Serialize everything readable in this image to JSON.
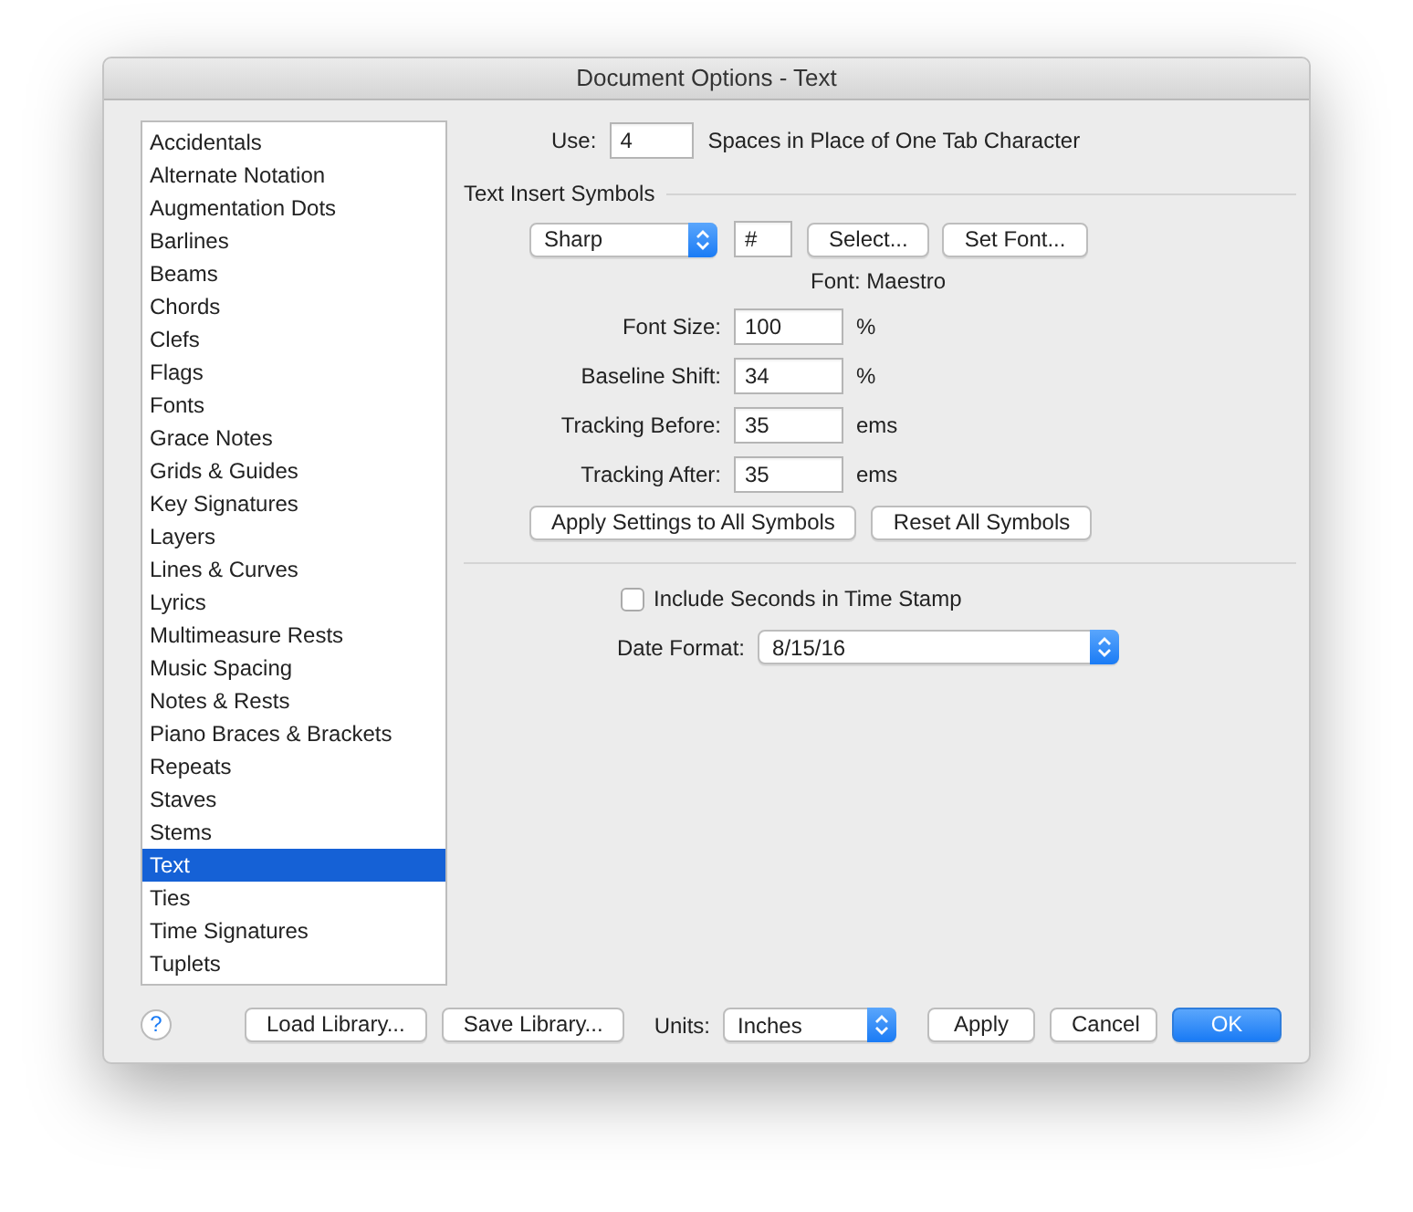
{
  "window": {
    "title": "Document Options - Text"
  },
  "categories": [
    {
      "label": "Accidentals",
      "selected": false
    },
    {
      "label": "Alternate Notation",
      "selected": false
    },
    {
      "label": "Augmentation Dots",
      "selected": false
    },
    {
      "label": "Barlines",
      "selected": false
    },
    {
      "label": "Beams",
      "selected": false
    },
    {
      "label": "Chords",
      "selected": false
    },
    {
      "label": "Clefs",
      "selected": false
    },
    {
      "label": "Flags",
      "selected": false
    },
    {
      "label": "Fonts",
      "selected": false
    },
    {
      "label": "Grace Notes",
      "selected": false
    },
    {
      "label": "Grids & Guides",
      "selected": false
    },
    {
      "label": "Key Signatures",
      "selected": false
    },
    {
      "label": "Layers",
      "selected": false
    },
    {
      "label": "Lines & Curves",
      "selected": false
    },
    {
      "label": "Lyrics",
      "selected": false
    },
    {
      "label": "Multimeasure Rests",
      "selected": false
    },
    {
      "label": "Music Spacing",
      "selected": false
    },
    {
      "label": "Notes & Rests",
      "selected": false
    },
    {
      "label": "Piano Braces & Brackets",
      "selected": false
    },
    {
      "label": "Repeats",
      "selected": false
    },
    {
      "label": "Staves",
      "selected": false
    },
    {
      "label": "Stems",
      "selected": false
    },
    {
      "label": "Text",
      "selected": true
    },
    {
      "label": "Ties",
      "selected": false
    },
    {
      "label": "Time Signatures",
      "selected": false
    },
    {
      "label": "Tuplets",
      "selected": false
    }
  ],
  "tab_spaces": {
    "label": "Use:",
    "value": "4",
    "suffix": "Spaces in Place of One Tab Character"
  },
  "text_insert_symbols": {
    "heading": "Text Insert Symbols",
    "symbol": "Sharp",
    "character": "#",
    "buttons": [
      "Select...",
      "Set Font..."
    ],
    "font": "Font: Maestro",
    "fields": [
      {
        "label": "Font Size:",
        "value": "100",
        "unit": "%"
      },
      {
        "label": "Baseline Shift:",
        "value": "34",
        "unit": "%"
      },
      {
        "label": "Tracking Before:",
        "value": "35",
        "unit": "ems"
      },
      {
        "label": "Tracking After:",
        "value": "35",
        "unit": "ems"
      }
    ],
    "actions": [
      "Apply Settings to All Symbols",
      "Reset All Symbols"
    ]
  },
  "time_stamp": {
    "label": "Include Seconds in Time Stamp",
    "checked": false
  },
  "date_format": {
    "label": "Date Format:",
    "value": "8/15/16"
  },
  "footer": {
    "help": "?",
    "library_buttons": [
      "Load Library...",
      "Save Library..."
    ],
    "units": {
      "label": "Units:",
      "value": "Inches"
    },
    "actions": [
      {
        "label": "Apply",
        "primary": false
      },
      {
        "label": "Cancel",
        "primary": false
      },
      {
        "label": "OK",
        "primary": true
      }
    ]
  }
}
